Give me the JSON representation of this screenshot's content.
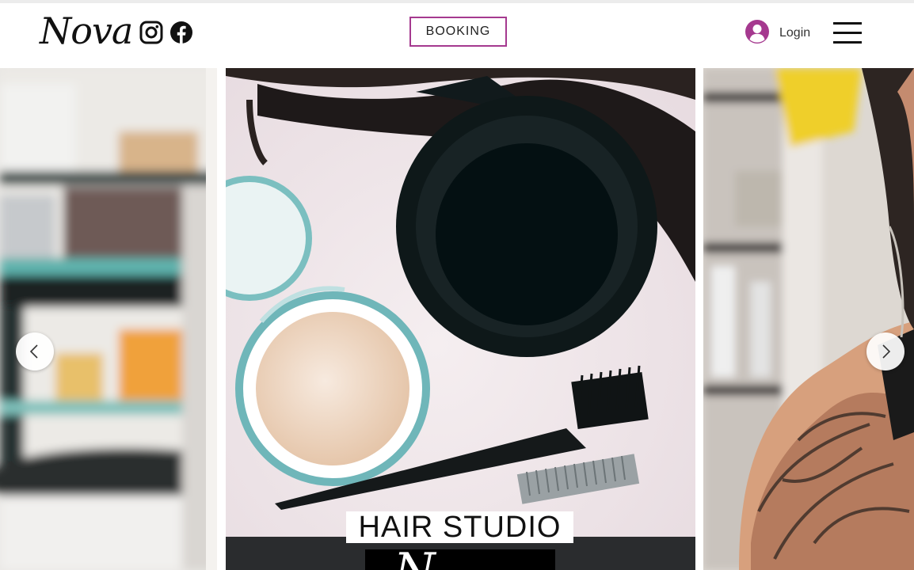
{
  "header": {
    "logo_text": "Nova",
    "social": [
      {
        "icon": "instagram-icon"
      },
      {
        "icon": "facebook-icon"
      }
    ],
    "booking_label": "BOOKING",
    "login_label": "Login",
    "accent_color": "#a5398f"
  },
  "gallery": {
    "caption_title": "HAIR STUDIO",
    "caption_script": "N",
    "prev_icon": "chevron-left-icon",
    "next_icon": "chevron-right-icon"
  }
}
